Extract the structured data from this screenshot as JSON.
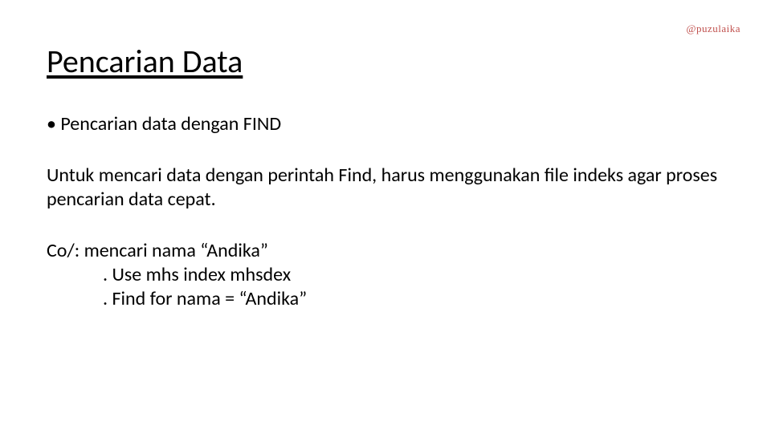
{
  "watermark": "@puzulaika",
  "title": "Pencarian Data",
  "bullet1": "• Pencarian data dengan FIND",
  "para1": "Untuk mencari data dengan perintah Find, harus menggunakan file indeks agar proses pencarian data cepat.",
  "example_intro": "Co/: mencari nama “Andika”",
  "example_line1": ". Use mhs index mhsdex",
  "example_line2": ". Find for nama = “Andika”"
}
